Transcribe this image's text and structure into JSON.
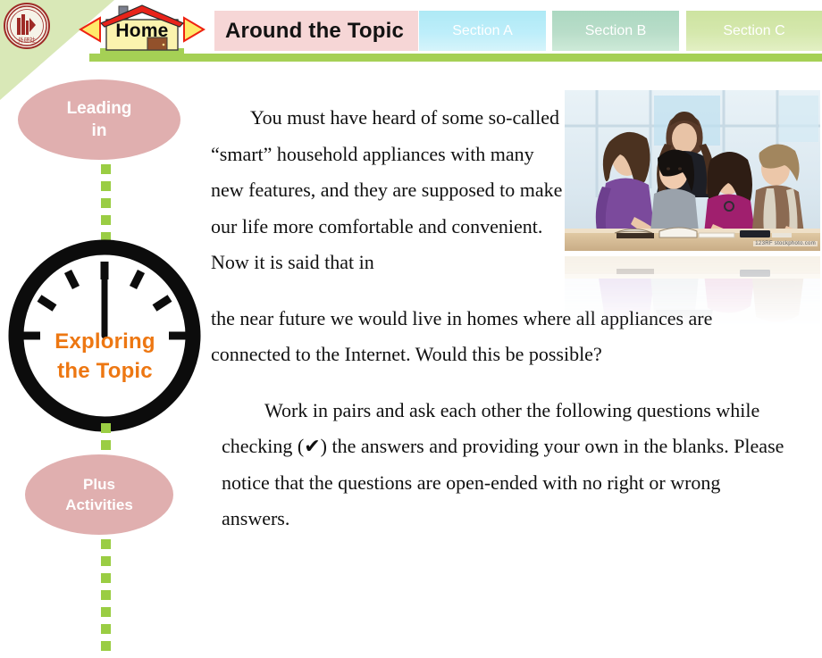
{
  "header": {
    "logo_icon": "publisher-seal-icon",
    "home_label": "Home",
    "prev_icon": "left-triangle-arrow-icon",
    "next_icon": "right-triangle-arrow-icon",
    "title": "Around the Topic",
    "tabs": [
      {
        "label": "Section A",
        "color": "#bdeefa"
      },
      {
        "label": "Section B",
        "color": "#b9ddc9"
      },
      {
        "label": "Section C",
        "color": "#d5e8ad"
      }
    ],
    "rule_color": "#a5d055",
    "title_chip_color": "#f6d6d6"
  },
  "sidebar": {
    "items": [
      {
        "name": "leading-in",
        "line1": "Leading",
        "line2": "in",
        "shape": "ellipse",
        "color": "#e0afaf"
      },
      {
        "name": "exploring-the-topic",
        "line1": "Exploring",
        "line2": "the Topic",
        "shape": "clock",
        "color": "#ed7712"
      },
      {
        "name": "plus-activities",
        "line1": "Plus",
        "line2": "Activities",
        "shape": "ellipse",
        "color": "#e0afaf"
      }
    ],
    "connector_color": "#9acd43",
    "clock_icon": "clock-icon"
  },
  "main": {
    "paragraphs": [
      "You must have heard of some so-called “smart” household appliances with many new features, and they are supposed to make our life more comfortable and convenient. Now it is said that in",
      "the near future we would live in homes where all appliances are connected to the Internet. Would this be possible?",
      "Work in pairs and ask each other the following questions while checking (✔) the answers and providing your own in the blanks. Please notice that the questions are open-ended with no right or wrong answers."
    ],
    "photo": {
      "name": "students-studying-photo",
      "alt": "Five young women studying together around a table with books",
      "credit": "123RF  stockphoto.com",
      "has_reflection": true
    }
  }
}
